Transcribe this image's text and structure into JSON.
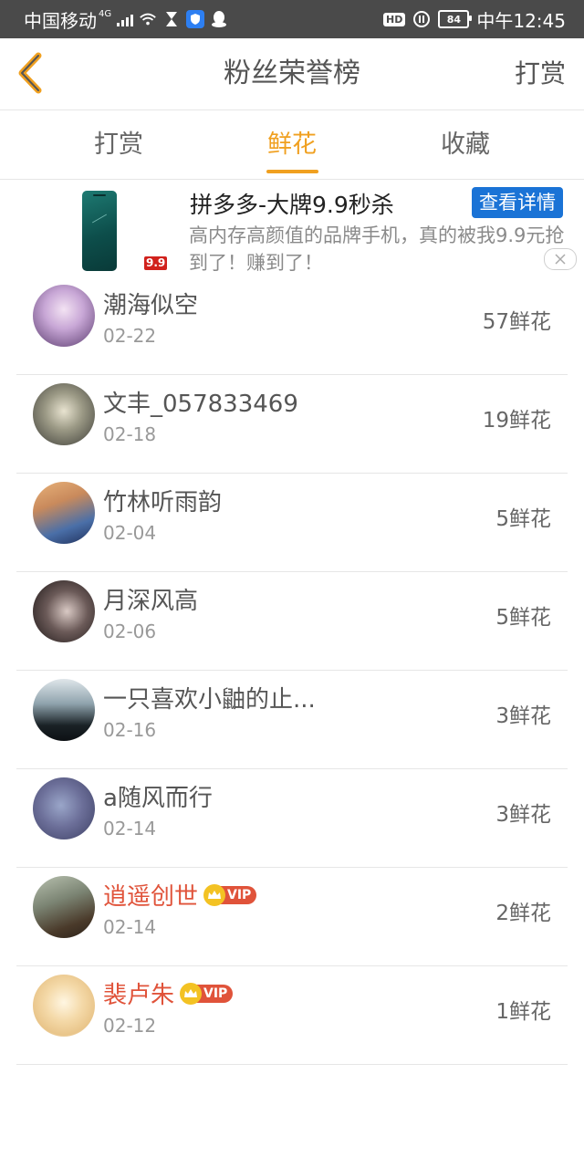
{
  "status_bar": {
    "carrier": "中国移动",
    "network": "4G",
    "hd": "HD",
    "battery": "84",
    "time": "中午12:45"
  },
  "header": {
    "title": "粉丝荣誉榜",
    "action_label": "打赏"
  },
  "tabs": [
    {
      "label": "打赏",
      "active": false
    },
    {
      "label": "鲜花",
      "active": true
    },
    {
      "label": "收藏",
      "active": false
    }
  ],
  "ad": {
    "price_tag": "9.9",
    "title": "拼多多-大牌9.9秒杀",
    "button_label": "查看详情",
    "description": "高内存高颜值的品牌手机，真的被我9.9元抢到了！赚到了！"
  },
  "fans": [
    {
      "name": "潮海似空",
      "date": "02-22",
      "count": "57鲜花",
      "vip": false
    },
    {
      "name": "文丰_057833469",
      "date": "02-18",
      "count": "19鲜花",
      "vip": false
    },
    {
      "name": "竹林听雨韵",
      "date": "02-04",
      "count": "5鲜花",
      "vip": false
    },
    {
      "name": "月深风高",
      "date": "02-06",
      "count": "5鲜花",
      "vip": false
    },
    {
      "name": "一只喜欢小鼬的止...",
      "date": "02-16",
      "count": "3鲜花",
      "vip": false
    },
    {
      "name": "a随风而行",
      "date": "02-14",
      "count": "3鲜花",
      "vip": false
    },
    {
      "name": "逍遥创世",
      "date": "02-14",
      "count": "2鲜花",
      "vip": true,
      "vip_label": "VIP"
    },
    {
      "name": "裴卢朱",
      "date": "02-12",
      "count": "1鲜花",
      "vip": true,
      "vip_label": "VIP"
    }
  ],
  "colors": {
    "accent": "#f0a020",
    "vip_name": "#e0533a",
    "ad_button": "#1a73d6"
  }
}
